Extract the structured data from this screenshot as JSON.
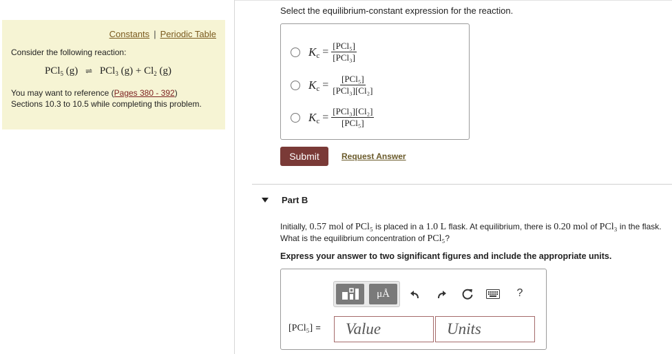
{
  "info": {
    "constants_link": "Constants",
    "separator": "|",
    "periodic_table_link": "Periodic Table",
    "consider": "Consider the following reaction:",
    "reaction": {
      "reactant": "PCl",
      "reactant_sub": "5",
      "reactant_state": "(g)",
      "arrow": "⇌",
      "product1": "PCl",
      "product1_sub": "3",
      "product1_state": "(g)",
      "plus": "+",
      "product2": "Cl",
      "product2_sub": "2",
      "product2_state": "(g)"
    },
    "ref_before": "You may want to reference (",
    "ref_link": "Pages 380 - 392",
    "ref_after": ") Sections 10.3 to 10.5 while completing this problem."
  },
  "part_a": {
    "prompt": "Select the equilibrium-constant expression for the reaction.",
    "kc_symbol": "K",
    "kc_sub": "c",
    "equals": "=",
    "choices": [
      {
        "num": "[PCl₅]",
        "den": "[PCl₃]"
      },
      {
        "num": "[PCl₅]",
        "den": "[PCl₃][Cl₂]"
      },
      {
        "num": "[PCl₃][Cl₂]",
        "den": "[PCl₅]"
      }
    ],
    "submit_label": "Submit",
    "request_answer_label": "Request Answer"
  },
  "part_b": {
    "title": "Part B",
    "q1": "Initially, ",
    "q_amt1": "0.57 mol",
    "q2": " of ",
    "q_sp1": "PCl₅",
    "q3": " is placed in a ",
    "q_vol": "1.0 L",
    "q4": " flask. At equilibrium, there is ",
    "q_amt2": "0.20 mol",
    "q5": " of ",
    "q_sp2": "PCl₃",
    "q6": " in the flask. What is the equilibrium concentration of ",
    "q_sp3": "PCl₅",
    "q7": "?",
    "instruction": "Express your answer to two significant figures and include the appropriate units.",
    "answer_label": "[PCl₅]",
    "answer_equals": "=",
    "value_placeholder": "Value",
    "units_placeholder": "Units",
    "toolbar": {
      "units_glyph": "μÅ",
      "help_glyph": "?"
    }
  }
}
